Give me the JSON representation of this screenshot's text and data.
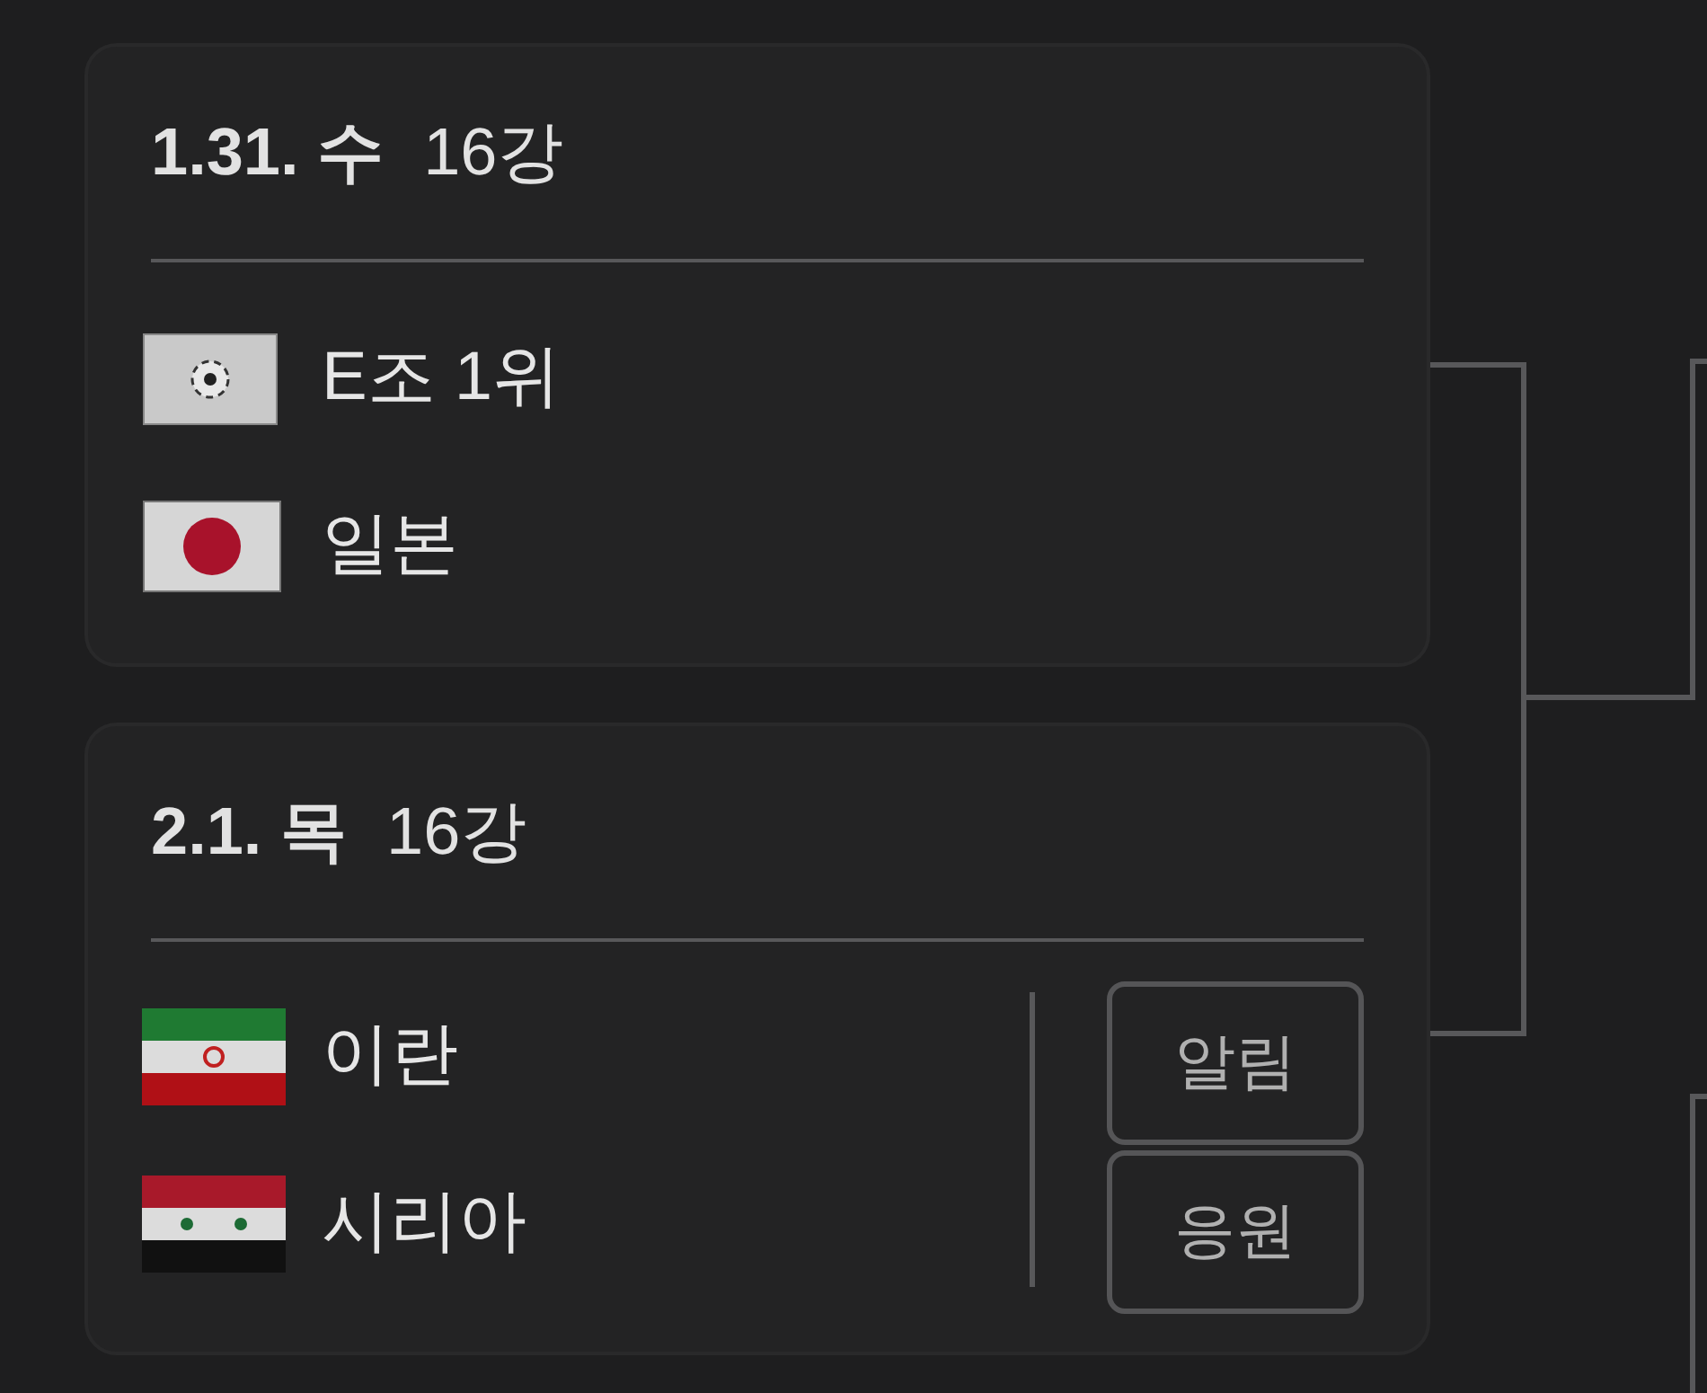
{
  "matches": [
    {
      "date": "1.31. 수",
      "round": "16강",
      "teams": [
        {
          "name": "E조 1위",
          "kind": "ball"
        },
        {
          "name": "일본",
          "kind": "japan"
        }
      ]
    },
    {
      "date": "2.1. 목",
      "round": "16강",
      "teams": [
        {
          "name": "이란",
          "kind": "iran"
        },
        {
          "name": "시리아",
          "kind": "syria"
        }
      ],
      "buttons": [
        "알림",
        "응원"
      ]
    }
  ]
}
